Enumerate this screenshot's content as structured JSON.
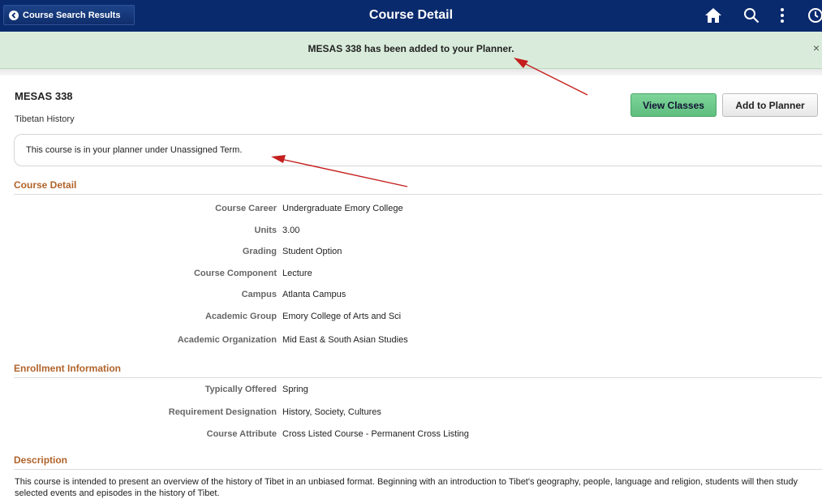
{
  "header": {
    "back_label": "Course Search Results",
    "title": "Course Detail",
    "icons": [
      "home-icon",
      "search-icon",
      "more-vertical-icon",
      "clock-icon"
    ]
  },
  "notification": {
    "message": "MESAS 338 has been added to your Planner.",
    "close_symbol": "×"
  },
  "course": {
    "code": "MESAS 338",
    "name": "Tibetan History",
    "view_classes_label": "View Classes",
    "add_planner_label": "Add to Planner",
    "planner_message": "This course is in your planner under Unassigned Term."
  },
  "sections": {
    "course_detail": "Course Detail",
    "enrollment": "Enrollment Information",
    "description": "Description"
  },
  "course_detail": [
    {
      "label": "Course Career",
      "value": "Undergraduate Emory College"
    },
    {
      "label": "Units",
      "value": "3.00"
    },
    {
      "label": "Grading",
      "value": "Student Option"
    },
    {
      "label": "Course Component",
      "value": "Lecture"
    },
    {
      "label": "Campus",
      "value": "Atlanta Campus"
    },
    {
      "label": "Academic Group",
      "value": "Emory College of Arts and Sci"
    },
    {
      "label": "Academic Organization",
      "value": "Mid East & South Asian Studies"
    }
  ],
  "enrollment": [
    {
      "label": "Typically Offered",
      "value": "Spring"
    },
    {
      "label": "Requirement Designation",
      "value": "History, Society, Cultures"
    },
    {
      "label": "Course Attribute",
      "value": "Cross Listed Course -  Permanent Cross Listing"
    }
  ],
  "description_text": "This course is intended to present an overview of the history of Tibet in an unbiased format. Beginning with an introduction to Tibet's geography, people, language and religion, students will then study selected events and episodes in the history of Tibet.",
  "colors": {
    "topbar": "#0a2a6e",
    "notification": "#d9ecdb",
    "section_header": "#b0632a",
    "view_button": "#6ccb8b",
    "annotation_arrow": "#c41e1e"
  }
}
